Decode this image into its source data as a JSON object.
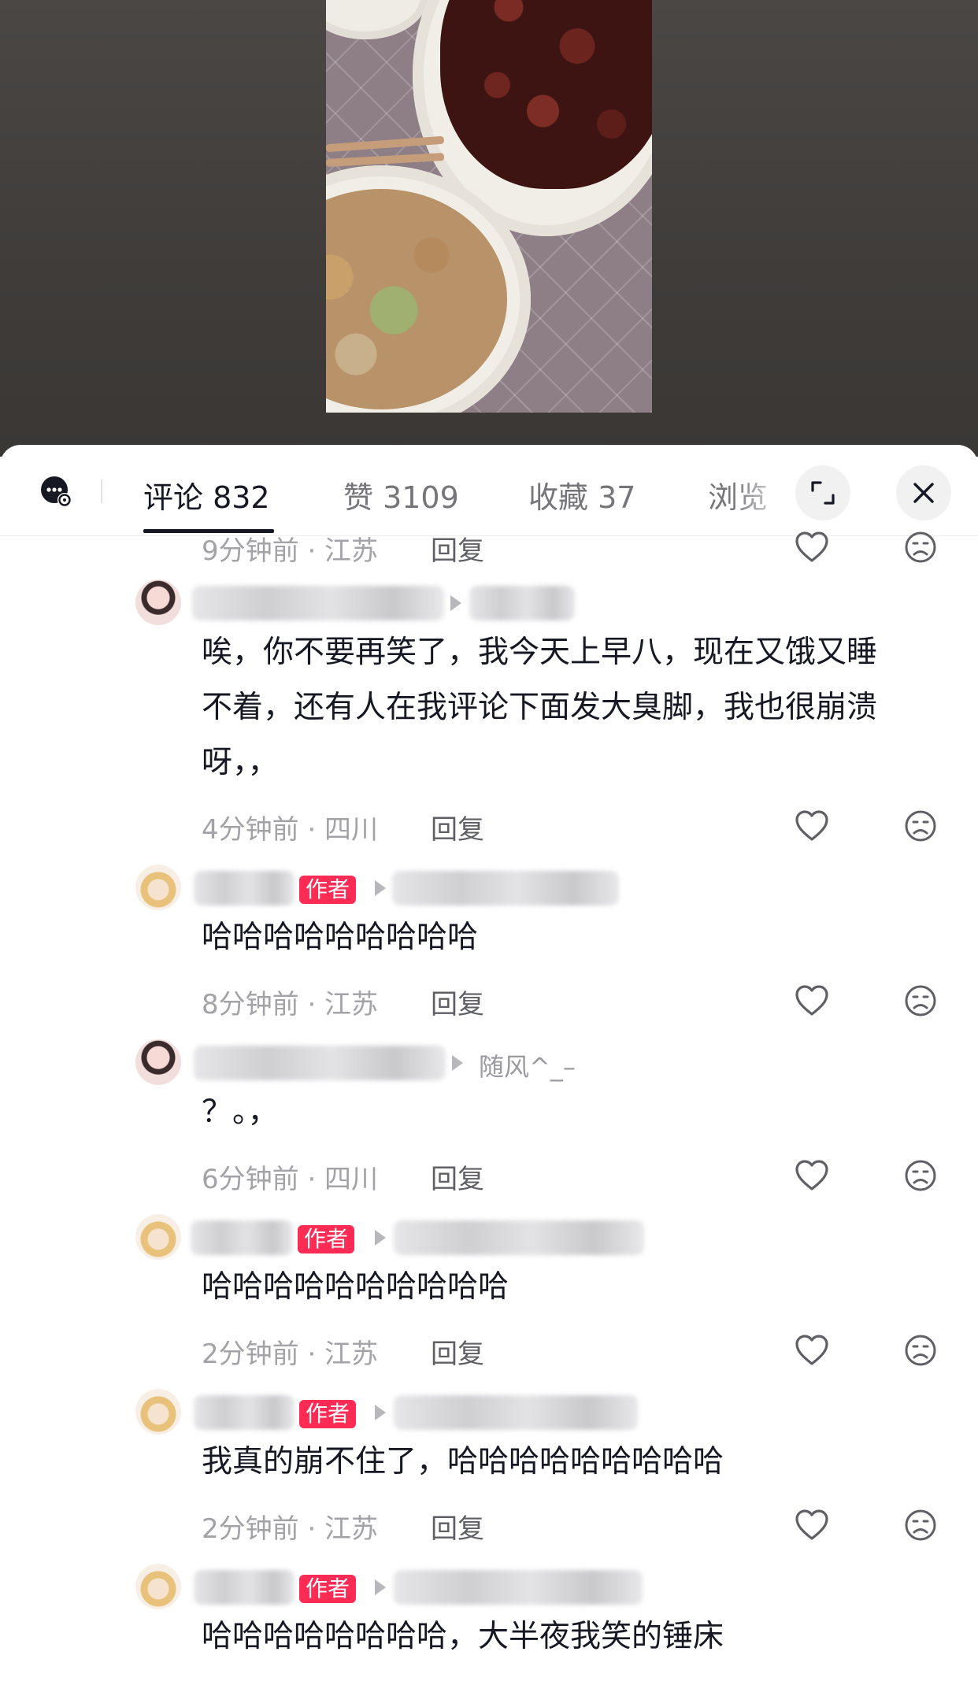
{
  "tabs": {
    "comments": "评论 832",
    "likes": "赞 3109",
    "favorites": "收藏 37",
    "views": "浏览"
  },
  "icons": {
    "comment_settings": "chat-bubble-settings-icon",
    "expand": "expand-icon",
    "close": "close-icon",
    "like": "heart-icon",
    "dislike": "frown-face-icon"
  },
  "colors": {
    "author_badge": "#fe2c55",
    "text_primary": "#161823",
    "text_meta": "#a3a3a7"
  },
  "top_meta": {
    "time_location": "9分钟前 · 江苏",
    "reply": "回复"
  },
  "comments": [
    {
      "text_lines": [
        "唉，你不要再笑了，我今天上早八，现在又饿又睡",
        "不着，还有人在我评论下面发大臭脚，我也很崩溃",
        "呀，，"
      ],
      "time_location": "4分钟前 · 四川",
      "reply": "回复"
    },
    {
      "badge": "作者",
      "text": "哈哈哈哈哈哈哈哈哈",
      "time_location": "8分钟前 · 江苏",
      "reply": "回复"
    },
    {
      "reply_to": "随风^_–",
      "text": "？。，",
      "time_location": "6分钟前 · 四川",
      "reply": "回复"
    },
    {
      "badge": "作者",
      "text": "哈哈哈哈哈哈哈哈哈哈",
      "time_location": "2分钟前 · 江苏",
      "reply": "回复"
    },
    {
      "badge": "作者",
      "text": "我真的崩不住了，哈哈哈哈哈哈哈哈哈",
      "time_location": "2分钟前 · 江苏",
      "reply": "回复"
    },
    {
      "badge": "作者",
      "text": "哈哈哈哈哈哈哈哈，大半夜我笑的锤床"
    }
  ]
}
